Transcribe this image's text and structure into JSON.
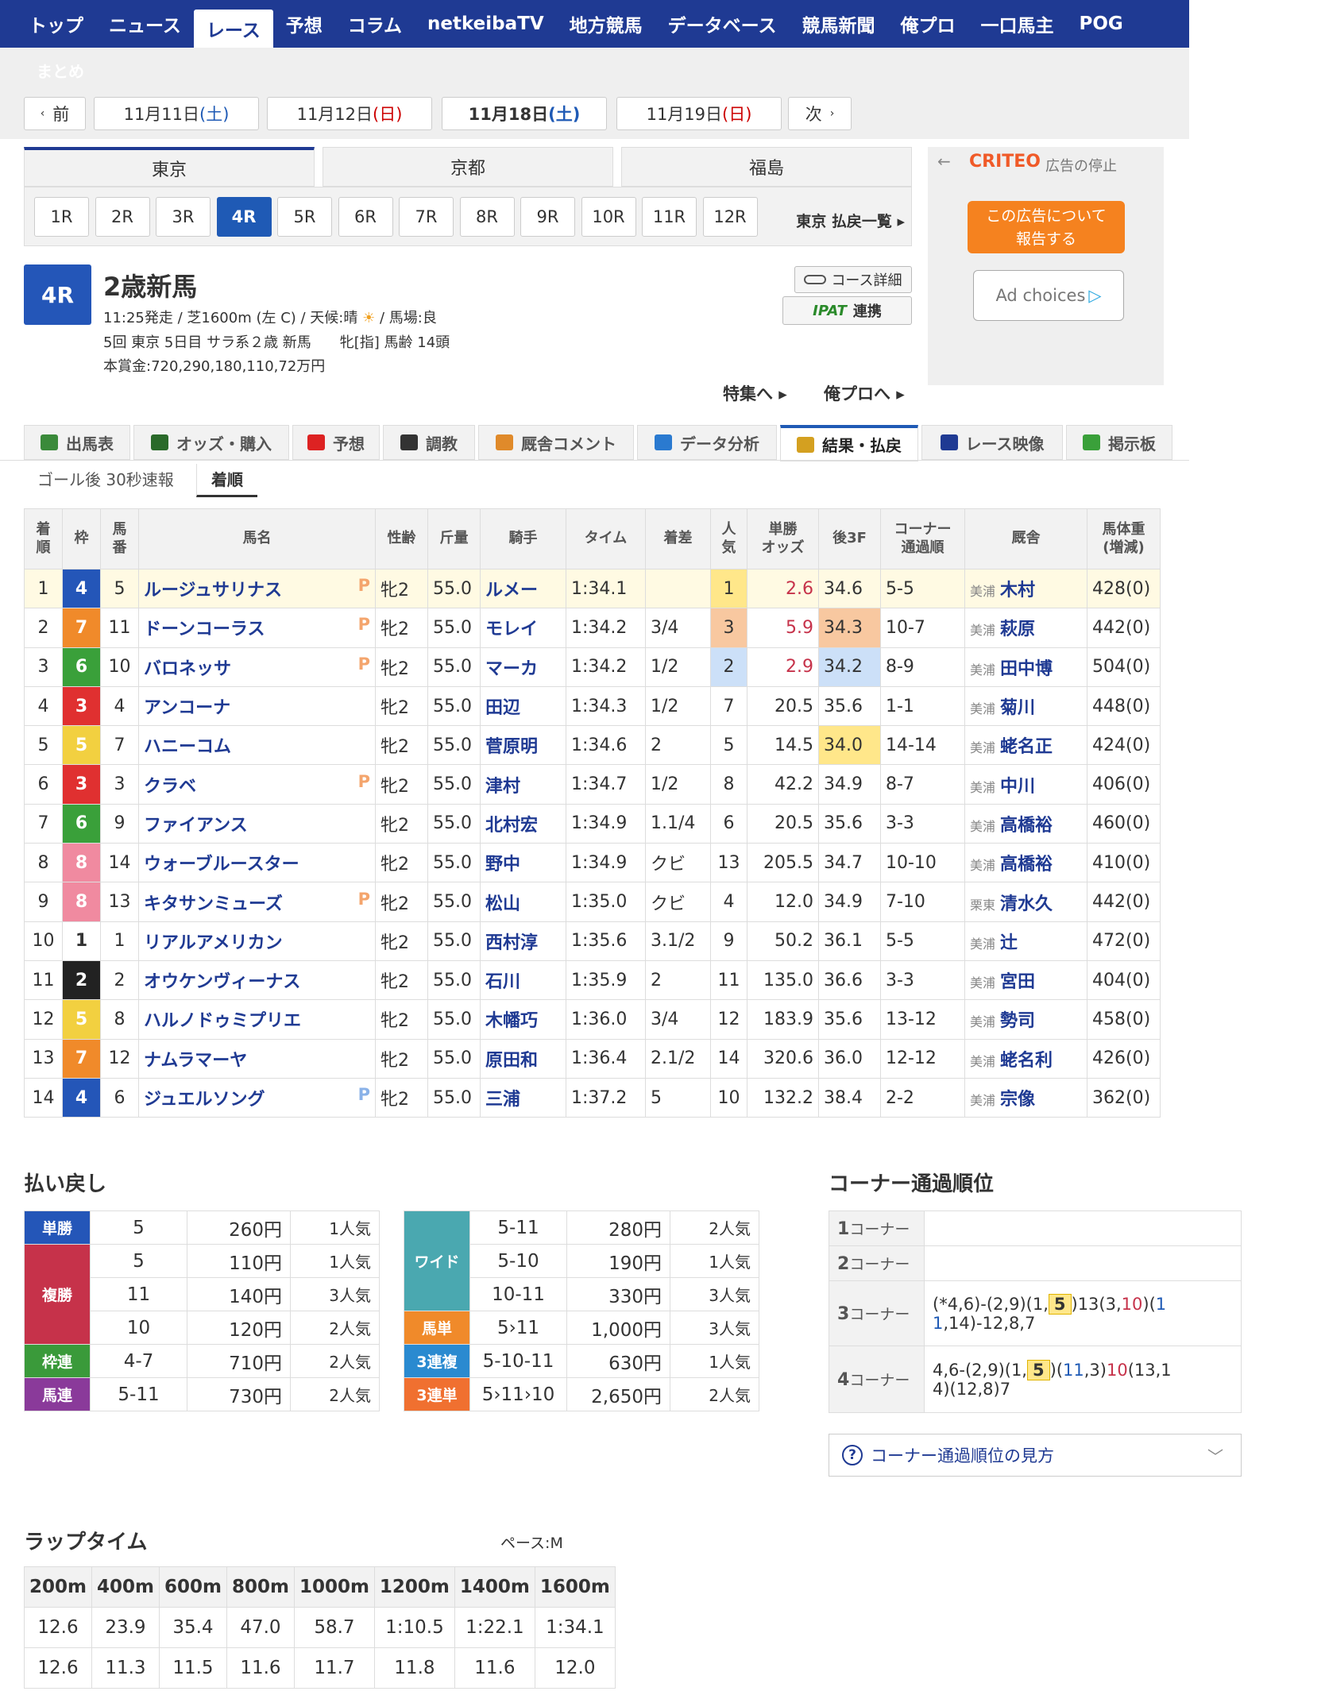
{
  "nav": {
    "items": [
      "トップ",
      "ニュース",
      "レース",
      "予想",
      "コラム",
      "netkeibaTV",
      "地方競馬",
      "データベース",
      "競馬新聞",
      "俺プロ",
      "一口馬主",
      "POG"
    ],
    "active": 2,
    "sub": "まとめ"
  },
  "dates": {
    "prev": "前",
    "next": "次",
    "items": [
      {
        "md": "11月11日",
        "dow": "(土)",
        "cls": "sat"
      },
      {
        "md": "11月12日",
        "dow": "(日)",
        "cls": "sun"
      },
      {
        "md": "11月18日",
        "dow": "(土)",
        "cls": "sat"
      },
      {
        "md": "11月19日",
        "dow": "(日)",
        "cls": "sun"
      }
    ]
  },
  "venues": [
    "東京",
    "京都",
    "福島"
  ],
  "races": [
    "1R",
    "2R",
    "3R",
    "4R",
    "5R",
    "6R",
    "7R",
    "8R",
    "9R",
    "10R",
    "11R",
    "12R"
  ],
  "payout_list": "東京 払戻一覧",
  "race": {
    "num": "4R",
    "name": "2歳新馬",
    "line1": "11:25発走 / 芝1600m (左 C) / 天候:晴",
    "line1b": "/ 馬場:良",
    "line2": "5回 東京 5日目 サラ系２歳 新馬　　牝[指] 馬齢 14頭",
    "line3": "本賞金:720,290,180,110,72万円",
    "course_btn": "コース詳細",
    "ipat_logo": "IPAT",
    "ipat": "連携",
    "tokushu": "特集へ",
    "orepro": "俺プロへ"
  },
  "ad": {
    "brand": "CRITEO",
    "stop": "広告の停止",
    "report": "この広告について報告する",
    "choices": "Ad choices"
  },
  "tabs": [
    {
      "label": "出馬表",
      "c": "#3a8a3a"
    },
    {
      "label": "オッズ・購入",
      "c": "#2a6a2a"
    },
    {
      "label": "予想",
      "c": "#d22"
    },
    {
      "label": "調教",
      "c": "#333"
    },
    {
      "label": "厩舎コメント",
      "c": "#e08a2a"
    },
    {
      "label": "データ分析",
      "c": "#2a7ad0"
    },
    {
      "label": "結果・払戻",
      "c": "#d4a020"
    },
    {
      "label": "レース映像",
      "c": "#1f3a93"
    },
    {
      "label": "掲示板",
      "c": "#3aa03a"
    }
  ],
  "subtabs": [
    "ゴール後 30秒速報",
    "着順"
  ],
  "headers": [
    "着\n順",
    "枠",
    "馬\n番",
    "馬名",
    "性齢",
    "斤量",
    "騎手",
    "タイム",
    "着差",
    "人\n気",
    "単勝\nオッズ",
    "後3F",
    "コーナー\n通過順",
    "厩舎",
    "馬体重\n(増減)"
  ],
  "rows": [
    [
      "1",
      "4",
      "5",
      "ルージュサリナス",
      "P",
      "牝2",
      "55.0",
      "ルメー",
      "1:34.1",
      "",
      "1",
      "2.6",
      "34.6",
      "5-5",
      "美浦",
      "木村",
      "428(0)"
    ],
    [
      "2",
      "7",
      "11",
      "ドーンコーラス",
      "P",
      "牝2",
      "55.0",
      "モレイ",
      "1:34.2",
      "3/4",
      "3",
      "5.9",
      "34.3",
      "10-7",
      "美浦",
      "萩原",
      "442(0)"
    ],
    [
      "3",
      "6",
      "10",
      "バロネッサ",
      "P",
      "牝2",
      "55.0",
      "マーカ",
      "1:34.2",
      "1/2",
      "2",
      "2.9",
      "34.2",
      "8-9",
      "美浦",
      "田中博",
      "504(0)"
    ],
    [
      "4",
      "3",
      "4",
      "アンコーナ",
      "",
      "牝2",
      "55.0",
      "田辺",
      "1:34.3",
      "1/2",
      "7",
      "20.5",
      "35.6",
      "1-1",
      "美浦",
      "菊川",
      "448(0)"
    ],
    [
      "5",
      "5",
      "7",
      "ハニーコム",
      "",
      "牝2",
      "55.0",
      "菅原明",
      "1:34.6",
      "2",
      "5",
      "14.5",
      "34.0",
      "14-14",
      "美浦",
      "蛯名正",
      "424(0)"
    ],
    [
      "6",
      "3",
      "3",
      "クラベ",
      "P",
      "牝2",
      "55.0",
      "津村",
      "1:34.7",
      "1/2",
      "8",
      "42.2",
      "34.9",
      "8-7",
      "美浦",
      "中川",
      "406(0)"
    ],
    [
      "7",
      "6",
      "9",
      "ファイアンス",
      "",
      "牝2",
      "55.0",
      "北村宏",
      "1:34.9",
      "1.1/4",
      "6",
      "20.5",
      "35.6",
      "3-3",
      "美浦",
      "高橋裕",
      "460(0)"
    ],
    [
      "8",
      "8",
      "14",
      "ウォーブルースター",
      "",
      "牝2",
      "55.0",
      "野中",
      "1:34.9",
      "クビ",
      "13",
      "205.5",
      "34.7",
      "10-10",
      "美浦",
      "高橋裕",
      "410(0)"
    ],
    [
      "9",
      "8",
      "13",
      "キタサンミューズ",
      "P",
      "牝2",
      "55.0",
      "松山",
      "1:35.0",
      "クビ",
      "4",
      "12.0",
      "34.9",
      "7-10",
      "栗東",
      "清水久",
      "442(0)"
    ],
    [
      "10",
      "1",
      "1",
      "リアルアメリカン",
      "",
      "牝2",
      "55.0",
      "西村淳",
      "1:35.6",
      "3.1/2",
      "9",
      "50.2",
      "36.1",
      "5-5",
      "美浦",
      "辻",
      "472(0)"
    ],
    [
      "11",
      "2",
      "2",
      "オウケンヴィーナス",
      "",
      "牝2",
      "55.0",
      "石川",
      "1:35.9",
      "2",
      "11",
      "135.0",
      "36.6",
      "3-3",
      "美浦",
      "宮田",
      "404(0)"
    ],
    [
      "12",
      "5",
      "8",
      "ハルノドゥミプリエ",
      "",
      "牝2",
      "55.0",
      "木幡巧",
      "1:36.0",
      "3/4",
      "12",
      "183.9",
      "35.6",
      "13-12",
      "美浦",
      "勢司",
      "458(0)"
    ],
    [
      "13",
      "7",
      "12",
      "ナムラマーヤ",
      "",
      "牝2",
      "55.0",
      "原田和",
      "1:36.4",
      "2.1/2",
      "14",
      "320.6",
      "36.0",
      "12-12",
      "美浦",
      "蛯名利",
      "426(0)"
    ],
    [
      "14",
      "4",
      "6",
      "ジュエルソング",
      "P",
      "牝2",
      "55.0",
      "三浦",
      "1:37.2",
      "5",
      "10",
      "132.2",
      "38.4",
      "2-2",
      "美浦",
      "宗像",
      "362(0)"
    ]
  ],
  "payouts_title": "払い戻し",
  "pay_left": [
    {
      "label": "単勝",
      "color": "#2456b8",
      "rows": [
        [
          "5",
          "260円",
          "1人気"
        ]
      ]
    },
    {
      "label": "複勝",
      "color": "#c6324a",
      "rows": [
        [
          "5",
          "110円",
          "1人気"
        ],
        [
          "11",
          "140円",
          "3人気"
        ],
        [
          "10",
          "120円",
          "2人気"
        ]
      ]
    },
    {
      "label": "枠連",
      "color": "#3a9a3a",
      "rows": [
        [
          "4-7",
          "710円",
          "2人気"
        ]
      ]
    },
    {
      "label": "馬連",
      "color": "#8a3a9a",
      "rows": [
        [
          "5-11",
          "730円",
          "2人気"
        ]
      ]
    }
  ],
  "pay_right": [
    {
      "label": "ワイド",
      "color": "#4aa8b0",
      "rows": [
        [
          "5-11",
          "280円",
          "2人気"
        ],
        [
          "5-10",
          "190円",
          "1人気"
        ],
        [
          "10-11",
          "330円",
          "3人気"
        ]
      ]
    },
    {
      "label": "馬単",
      "color": "#f08a2a",
      "rows": [
        [
          "5›11",
          "1,000円",
          "3人気"
        ]
      ]
    },
    {
      "label": "3連複",
      "color": "#2a8ad0",
      "rows": [
        [
          "5-10-11",
          "630円",
          "1人気"
        ]
      ]
    },
    {
      "label": "3連単",
      "color": "#f07030",
      "rows": [
        [
          "5›11›10",
          "2,650円",
          "2人気"
        ]
      ]
    }
  ],
  "corner_title": "コーナー通過順位",
  "corners": [
    "1コーナー",
    "2コーナー",
    "3コーナー",
    "4コーナー"
  ],
  "corner_help": "コーナー通過順位の見方",
  "lap_title": "ラップタイム",
  "pace": "ペース:M",
  "lap_headers": [
    "200m",
    "400m",
    "600m",
    "800m",
    "1000m",
    "1200m",
    "1400m",
    "1600m"
  ],
  "lap_cum": [
    "12.6",
    "23.9",
    "35.4",
    "47.0",
    "58.7",
    "1:10.5",
    "1:22.1",
    "1:34.1"
  ],
  "lap_split": [
    "12.6",
    "11.3",
    "11.5",
    "11.6",
    "11.7",
    "11.8",
    "11.6",
    "12.0"
  ],
  "colors": {
    "waku": {
      "1": "#ffffff",
      "2": "#222222",
      "3": "#e03030",
      "4": "#2456b8",
      "5": "#f2d040",
      "6": "#3aa03a",
      "7": "#f08a2a",
      "8": "#f08aa0"
    }
  }
}
